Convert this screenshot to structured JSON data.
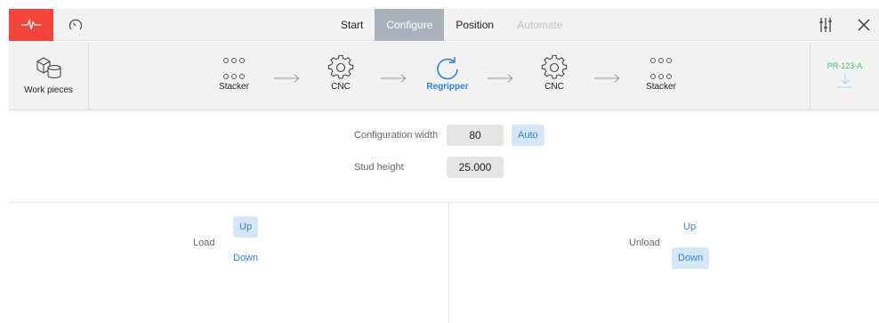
{
  "topbar": {
    "left_icons": [
      "pulse-icon",
      "gauge-icon"
    ],
    "tabs": [
      {
        "label": "Start",
        "state": "normal"
      },
      {
        "label": "Configure",
        "state": "active"
      },
      {
        "label": "Position",
        "state": "normal"
      },
      {
        "label": "Automate",
        "state": "disabled"
      }
    ],
    "right_icons": [
      "sliders-icon",
      "close-icon"
    ]
  },
  "flow": {
    "workpieces_label": "Work pieces",
    "steps": [
      {
        "label": "Stacker",
        "icon": "stacker-dots-icon"
      },
      {
        "label": "CNC",
        "icon": "gear-icon"
      },
      {
        "label": "Regripper",
        "icon": "regripper-rotate-icon",
        "active": true
      },
      {
        "label": "CNC",
        "icon": "gear-icon"
      },
      {
        "label": "Stacker",
        "icon": "stacker-dots-icon"
      }
    ],
    "program": {
      "name": "PR-123-A",
      "icon": "download-icon"
    }
  },
  "config": {
    "width_label": "Configuration width",
    "width_value": "80",
    "auto_label": "Auto",
    "stud_label": "Stud height",
    "stud_value": "25.000"
  },
  "load": {
    "label": "Load",
    "up": "Up",
    "down": "Down",
    "selected": "Up"
  },
  "unload": {
    "label": "Unload",
    "up": "Up",
    "down": "Down",
    "selected": "Down"
  },
  "colors": {
    "accent": "#2f7fe0",
    "alarm": "#f2443a",
    "active_tab": "#a8b1bd",
    "chip": "#d5e7fa",
    "program": "#3ec46d"
  }
}
